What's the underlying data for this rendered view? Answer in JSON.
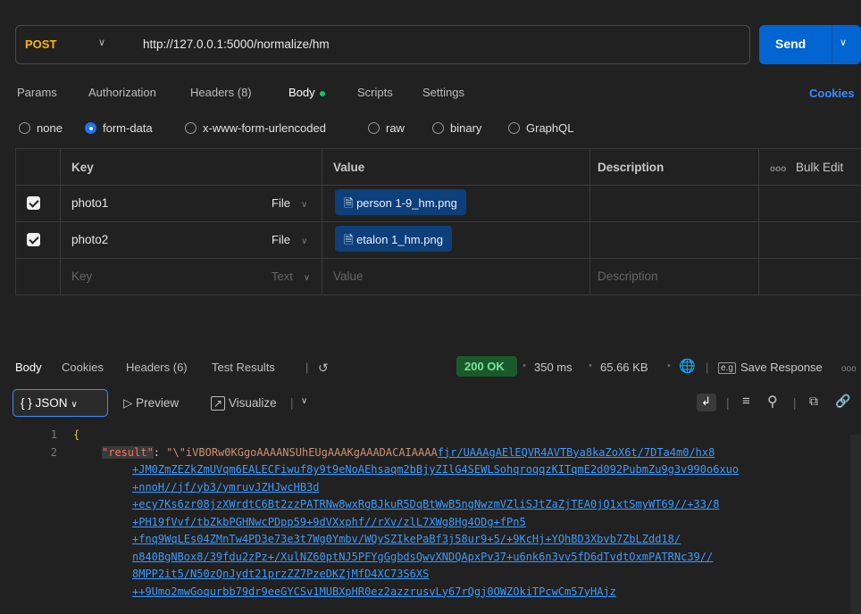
{
  "request": {
    "method": "POST",
    "url": "http://127.0.0.1:5000/normalize/hm",
    "send_label": "Send"
  },
  "request_tabs": {
    "params": "Params",
    "authorization": "Authorization",
    "headers": "Headers (8)",
    "body": "Body",
    "scripts": "Scripts",
    "settings": "Settings",
    "cookies": "Cookies"
  },
  "body_types": {
    "none": "none",
    "form_data": "form-data",
    "urlencoded": "x-www-form-urlencoded",
    "raw": "raw",
    "binary": "binary",
    "graphql": "GraphQL",
    "selected": "form-data"
  },
  "params_table": {
    "headers": {
      "key": "Key",
      "value": "Value",
      "description": "Description",
      "bulk_edit": "Bulk Edit",
      "more": "ooo"
    },
    "rows": [
      {
        "key": "photo1",
        "type": "File",
        "value": "person 1-9_hm.png",
        "checked": true
      },
      {
        "key": "photo2",
        "type": "File",
        "value": "etalon 1_hm.png",
        "checked": true
      }
    ],
    "placeholder": {
      "key": "Key",
      "type": "Text",
      "value": "Value",
      "description": "Description"
    }
  },
  "response_tabs": {
    "body": "Body",
    "cookies": "Cookies",
    "headers": "Headers (6)",
    "test_results": "Test Results"
  },
  "response_meta": {
    "status": "200 OK",
    "time": "350 ms",
    "size": "65.66 KB",
    "save_response": "Save Response",
    "more": "ooo"
  },
  "viewer": {
    "format": "JSON",
    "preview": "Preview",
    "visualize": "Visualize"
  },
  "code": {
    "line_numbers": [
      "1",
      "2"
    ],
    "line1": "{",
    "key": "\"result\"",
    "colon": ": ",
    "value_start": "\"\\\"iVBORw0KGgoAAAANSUhEUgAAAKgAAADACAIAAAA",
    "value_link_first": "fjr/UAAAgAElEQVR4AVTBya8kaZoX6t/7DTa4m0/hx8",
    "continuation_lines": [
      "+JM0ZmZEZkZmUVqm6EALECFiwuf8y9t9eNoAEhsaqm2bBjyZIlG4SEWLSohqroqqzKITqmE2d092PubmZu9g3v990o6xuo",
      "+nnoH//jf/yb3/ymruvJZHJwcHB3d",
      "+ecy7Ks6zr08jzXWrdtC6Bt2zzPATRNw8wxRgBJkuR5DqBtWwB5ngNwzmVZliSJtZaZjTEA0jQ1xtSmyWT69//+33/8",
      "+PH19fVvf/tbZkbPGHNwcPDpp59+9dVXxphf//rXv/zlL7XWg8Hg4ODg+fPn5",
      "+fnq9WqLEs04ZMnTw4PD3e73e3t7Wg0Ymbv/WQySZIkePaBf3j58ur9+5/+9KcHj+YQhBD3Xbvb7ZbLZdd18/",
      "n840BgNBox8/39fdu2zPz+/XulNZ60ptNJ5PFYgGgbdsQwvXNDQApxPv37+u6nk6n3vv5fD6dTvdtOxmPATRNc39//",
      "8MPP2it5/N50zQnJydt21przZZ7PzeDKZjMfD4XC73S6XS",
      "++9Umo2mwGoqurbb79dr9eeGYCSv1MUBXpHR0ez2azzrusvLy67rQgj0OWZOkiTPcwCm57yHAjz"
    ]
  }
}
